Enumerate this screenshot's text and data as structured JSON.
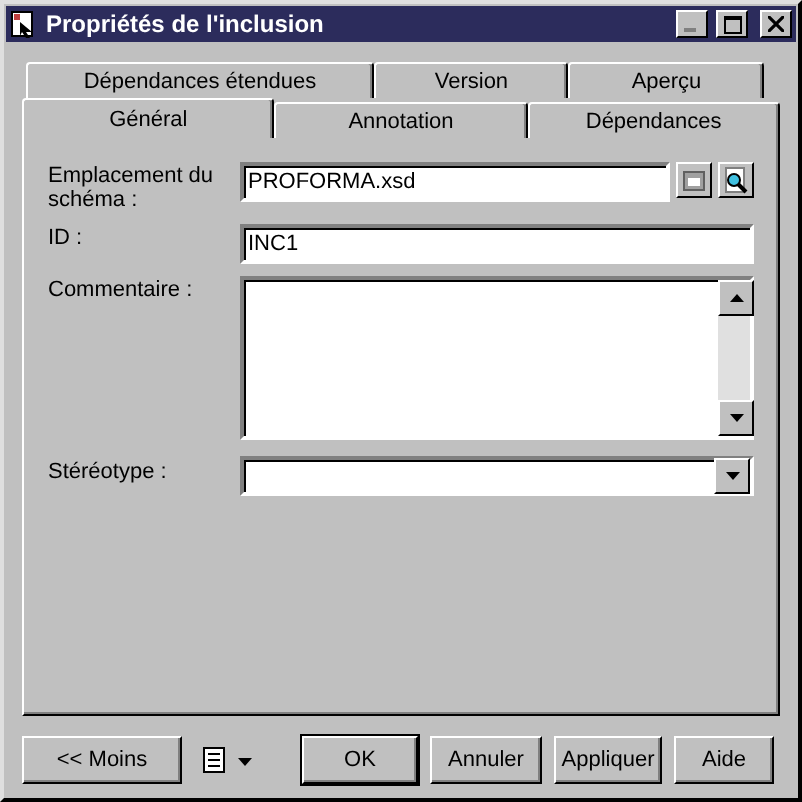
{
  "window": {
    "title": "Propriétés de l'inclusion"
  },
  "tab_rows": [
    [
      {
        "label": "Dépendances étendues",
        "selected": false
      },
      {
        "label": "Version",
        "selected": false
      },
      {
        "label": "Aperçu",
        "selected": false
      }
    ],
    [
      {
        "label": "Général",
        "selected": true
      },
      {
        "label": "Annotation",
        "selected": false
      },
      {
        "label": "Dépendances",
        "selected": false
      }
    ]
  ],
  "fields": [
    {
      "kind": "browse",
      "label": "Emplacement du schéma :",
      "value": "PROFORMA.xsd"
    },
    {
      "kind": "text",
      "label": "ID :",
      "value": "INC1"
    },
    {
      "kind": "memo",
      "label": "Commentaire :"
    },
    {
      "kind": "combo",
      "label": "Stéréotype :"
    }
  ],
  "buttons": [
    {
      "label": "<< Moins",
      "default": false
    },
    {
      "label": "OK",
      "default": true
    },
    {
      "label": "Annuler",
      "default": false
    },
    {
      "label": "Appliquer",
      "default": false
    },
    {
      "label": "Aide",
      "default": false
    }
  ]
}
